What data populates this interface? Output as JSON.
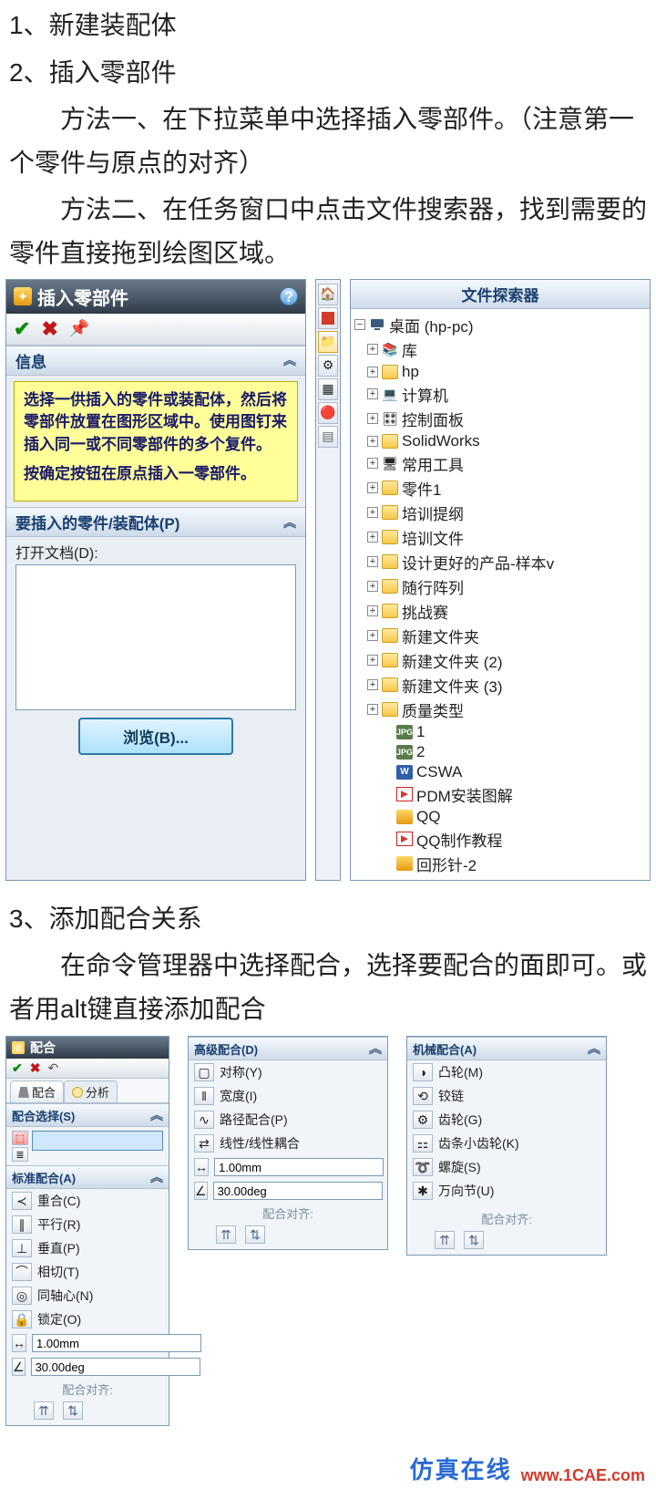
{
  "doc": {
    "line1": "1、新建装配体",
    "line2": "2、插入零部件",
    "line3": "方法一、在下拉菜单中选择插入零部件。（注意第一个零件与原点的对齐）",
    "line4": "方法二、在任务窗口中点击文件搜索器，找到需要的零件直接拖到绘图区域。",
    "line5": "3、添加配合关系",
    "line6": "在命令管理器中选择配合，选择要配合的面即可。或者用alt键直接添加配合"
  },
  "insert_panel": {
    "title": "插入零部件",
    "info_head": "信息",
    "info_p1": "选择一供插入的零件或装配体，然后将零部件放置在图形区域中。使用图钉来插入同一或不同零部件的多个复件。",
    "info_p2": "按确定按钮在原点插入一零部件。",
    "parts_head": "要插入的零件/装配体(P)",
    "open_doc": "打开文档(D):",
    "browse": "浏览(B)..."
  },
  "explorer": {
    "title": "文件探索器",
    "root": "桌面 (hp-pc)",
    "items": [
      {
        "icon": "lib",
        "label": "库"
      },
      {
        "icon": "folder",
        "label": "hp"
      },
      {
        "icon": "pc",
        "label": "计算机"
      },
      {
        "icon": "cpl",
        "label": "控制面板"
      },
      {
        "icon": "folder",
        "label": "SolidWorks"
      },
      {
        "icon": "tool",
        "label": "常用工具"
      },
      {
        "icon": "folder",
        "label": "零件1"
      },
      {
        "icon": "folder",
        "label": "培训提纲"
      },
      {
        "icon": "folder",
        "label": "培训文件"
      },
      {
        "icon": "folder",
        "label": "设计更好的产品-样本v"
      },
      {
        "icon": "folder",
        "label": "随行阵列"
      },
      {
        "icon": "folder",
        "label": "挑战赛"
      },
      {
        "icon": "folder",
        "label": "新建文件夹"
      },
      {
        "icon": "folder",
        "label": "新建文件夹 (2)"
      },
      {
        "icon": "folder",
        "label": "新建文件夹 (3)"
      },
      {
        "icon": "folder",
        "label": "质量类型"
      },
      {
        "icon": "jpg",
        "label": "1",
        "leaf": true
      },
      {
        "icon": "jpg",
        "label": "2",
        "leaf": true
      },
      {
        "icon": "doc",
        "label": "CSWA",
        "leaf": true
      },
      {
        "icon": "pdf",
        "label": "PDM安装图解",
        "leaf": true
      },
      {
        "icon": "ink",
        "label": "QQ",
        "leaf": true
      },
      {
        "icon": "pdf",
        "label": "QQ制作教程",
        "leaf": true
      },
      {
        "icon": "ink",
        "label": "回形针-2",
        "leaf": true
      }
    ]
  },
  "mate_panel": {
    "title": "配合",
    "tab_mate": "配合",
    "tab_analysis": "分析",
    "selection_head": "配合选择(S)",
    "std_head": "标准配合(A)",
    "std": [
      {
        "l": "重合(C)"
      },
      {
        "l": "平行(R)"
      },
      {
        "l": "垂直(P)"
      },
      {
        "l": "相切(T)"
      },
      {
        "l": "同轴心(N)"
      },
      {
        "l": "锁定(O)"
      }
    ],
    "dist_value": "1.00mm",
    "ang_value": "30.00deg",
    "align": "配合对齐:"
  },
  "adv_panel": {
    "head": "高级配合(D)",
    "items": [
      {
        "l": "对称(Y)"
      },
      {
        "l": "宽度(I)"
      },
      {
        "l": "路径配合(P)"
      },
      {
        "l": "线性/线性耦合"
      }
    ],
    "dist_value": "1.00mm",
    "ang_value": "30.00deg",
    "align": "配合对齐:"
  },
  "mech_panel": {
    "head": "机械配合(A)",
    "items": [
      {
        "l": "凸轮(M)"
      },
      {
        "l": "铰链"
      },
      {
        "l": "齿轮(G)"
      },
      {
        "l": "齿条小齿轮(K)"
      },
      {
        "l": "螺旋(S)"
      },
      {
        "l": "万向节(U)"
      }
    ],
    "align": "配合对齐:"
  },
  "footer": {
    "brand": "仿真在线",
    "url": "www.1CAE.com"
  }
}
